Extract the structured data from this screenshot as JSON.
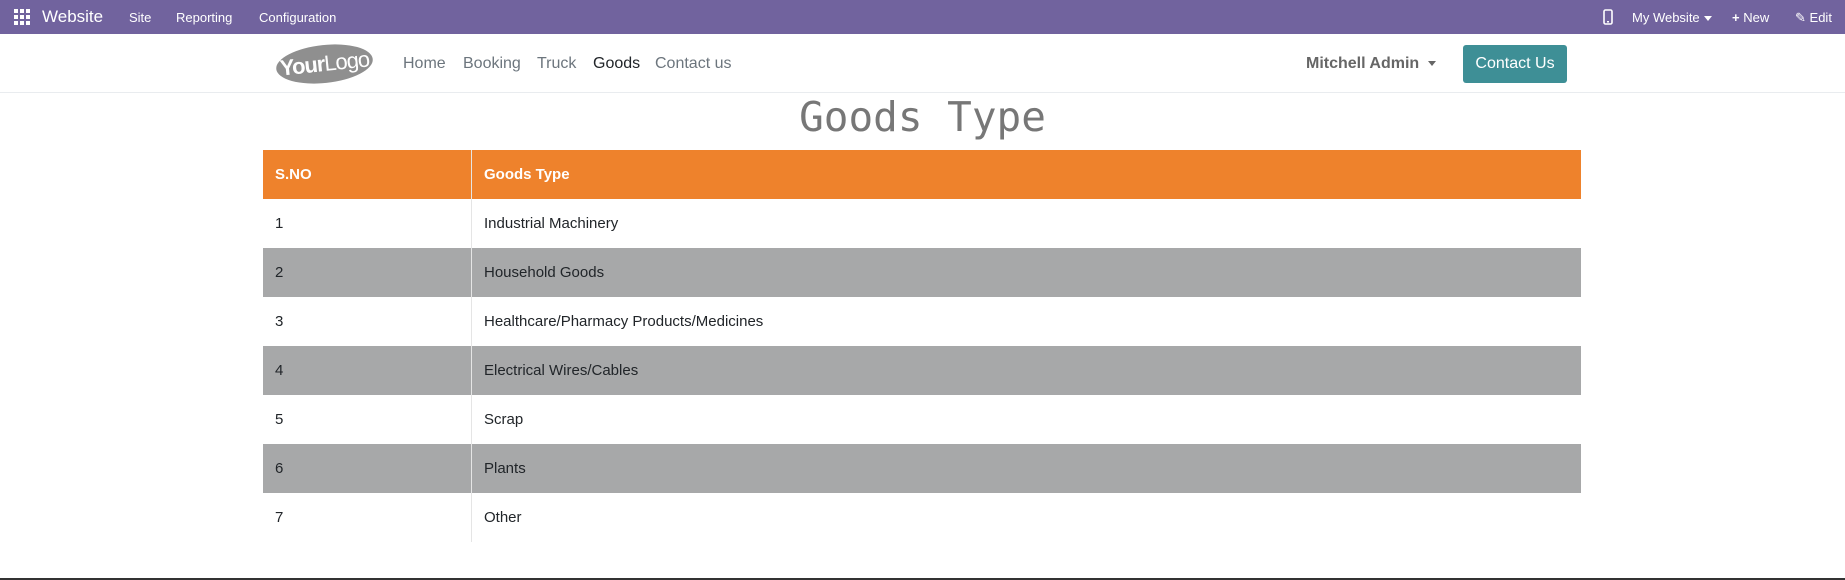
{
  "admin_bar": {
    "brand": "Website",
    "menus": [
      "Site",
      "Reporting",
      "Configuration"
    ],
    "website_selector": "My Website",
    "new_label": "New",
    "edit_label": "Edit"
  },
  "header": {
    "logo_text_bold": "Your",
    "logo_text": "Logo",
    "nav": [
      "Home",
      "Booking",
      "Truck",
      "Goods",
      "Contact us"
    ],
    "active_nav": "Goods",
    "user": "Mitchell Admin",
    "contact_button": "Contact Us"
  },
  "main": {
    "title": "Goods Type",
    "columns": [
      "S.NO",
      "Goods Type"
    ],
    "rows": [
      [
        "1",
        "Industrial Machinery"
      ],
      [
        "2",
        "Household Goods"
      ],
      [
        "3",
        "Healthcare/Pharmacy Products/Medicines"
      ],
      [
        "4",
        "Electrical Wires/Cables"
      ],
      [
        "5",
        "Scrap"
      ],
      [
        "6",
        "Plants"
      ],
      [
        "7",
        "Other"
      ]
    ]
  },
  "colors": {
    "admin_bar": "#71639e",
    "table_header": "#ee822c",
    "stripe": "#a7a8a9",
    "contact_button": "#3e8f96"
  }
}
